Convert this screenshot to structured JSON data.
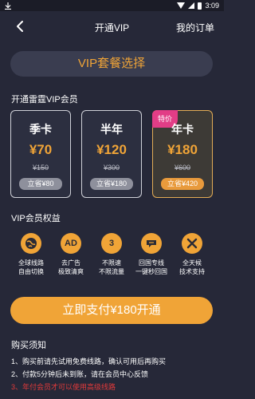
{
  "status_bar": {
    "time": "3:09"
  },
  "nav": {
    "title": "开通VIP",
    "orders": "我的订单"
  },
  "plan_header": "VIP套餐选择",
  "membership_title": "开通雷霆VIP会员",
  "cards": [
    {
      "name": "季卡",
      "price": "¥70",
      "original": "¥150",
      "save": "立省¥80",
      "selected": false
    },
    {
      "name": "半年",
      "price": "¥120",
      "original": "¥300",
      "save": "立省¥180",
      "selected": false
    },
    {
      "name": "年卡",
      "price": "¥180",
      "original": "¥600",
      "save": "立省¥420",
      "selected": true,
      "badge": "特价"
    }
  ],
  "benefits_title": "VIP会员权益",
  "benefits": [
    {
      "icon": "globe-icon",
      "glyph": "",
      "line1": "全球线路",
      "line2": "自由切换"
    },
    {
      "icon": "ad-block-icon",
      "glyph": "AD",
      "line1": "去广告",
      "line2": "极致清爽"
    },
    {
      "icon": "speed-limit-icon",
      "glyph": "3",
      "line1": "不限速",
      "line2": "不限流量"
    },
    {
      "icon": "chat-return-icon",
      "glyph": "",
      "line1": "回国专线",
      "line2": "一键秒回国"
    },
    {
      "icon": "tools-icon",
      "glyph": "",
      "line1": "全天候",
      "line2": "技术支持"
    }
  ],
  "pay_button": "立即支付¥180开通",
  "notice": {
    "title": "购买须知",
    "lines": [
      "1、购买前请先试用免费线路，确认可用后再购买",
      "2、付款5分钟后未到账，请在会员中心反馈",
      "3、年付会员才可以使用高级线路"
    ]
  },
  "colors": {
    "background": "#262838",
    "accent": "#f0a437",
    "badge": "#e23d86",
    "warning": "#e23a3a"
  }
}
